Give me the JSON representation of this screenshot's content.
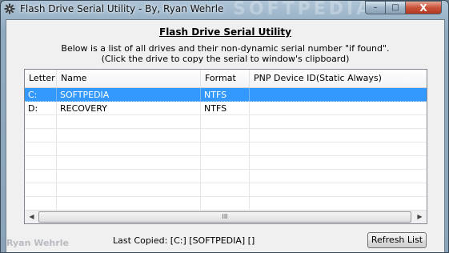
{
  "window": {
    "title": "Flash Drive Serial Utility - By, Ryan Wehrle",
    "watermark": "SOFTPEDIA",
    "icon": "app-gear-icon",
    "minimize_glyph": "–",
    "maximize_glyph": "□",
    "close_glyph": "X"
  },
  "header": {
    "title": "Flash Drive Serial Utility",
    "line1": "Below is a list of all drives and their non-dynamic serial number \"if found\".",
    "line2": "(Click the drive to copy the serial to window's clipboard)"
  },
  "table": {
    "columns": [
      "Letter",
      "Name",
      "Format",
      "PNP Device ID(Static Always)"
    ],
    "rows": [
      {
        "letter": "C:",
        "name": "SOFTPEDIA",
        "format": "NTFS",
        "pnp": "",
        "selected": true
      },
      {
        "letter": "D:",
        "name": "RECOVERY",
        "format": "NTFS",
        "pnp": "",
        "selected": false
      }
    ],
    "scroll_left_icon": "◀",
    "scroll_right_icon": "▶",
    "scroll_grip": "III"
  },
  "footer": {
    "author": "Ryan Wehrle",
    "last_copied": "Last Copied: [C:] [SOFTPEDIA] []",
    "refresh_label": "Refresh List"
  },
  "colors": {
    "selection": "#3399ff",
    "close_button": "#c9533a"
  }
}
